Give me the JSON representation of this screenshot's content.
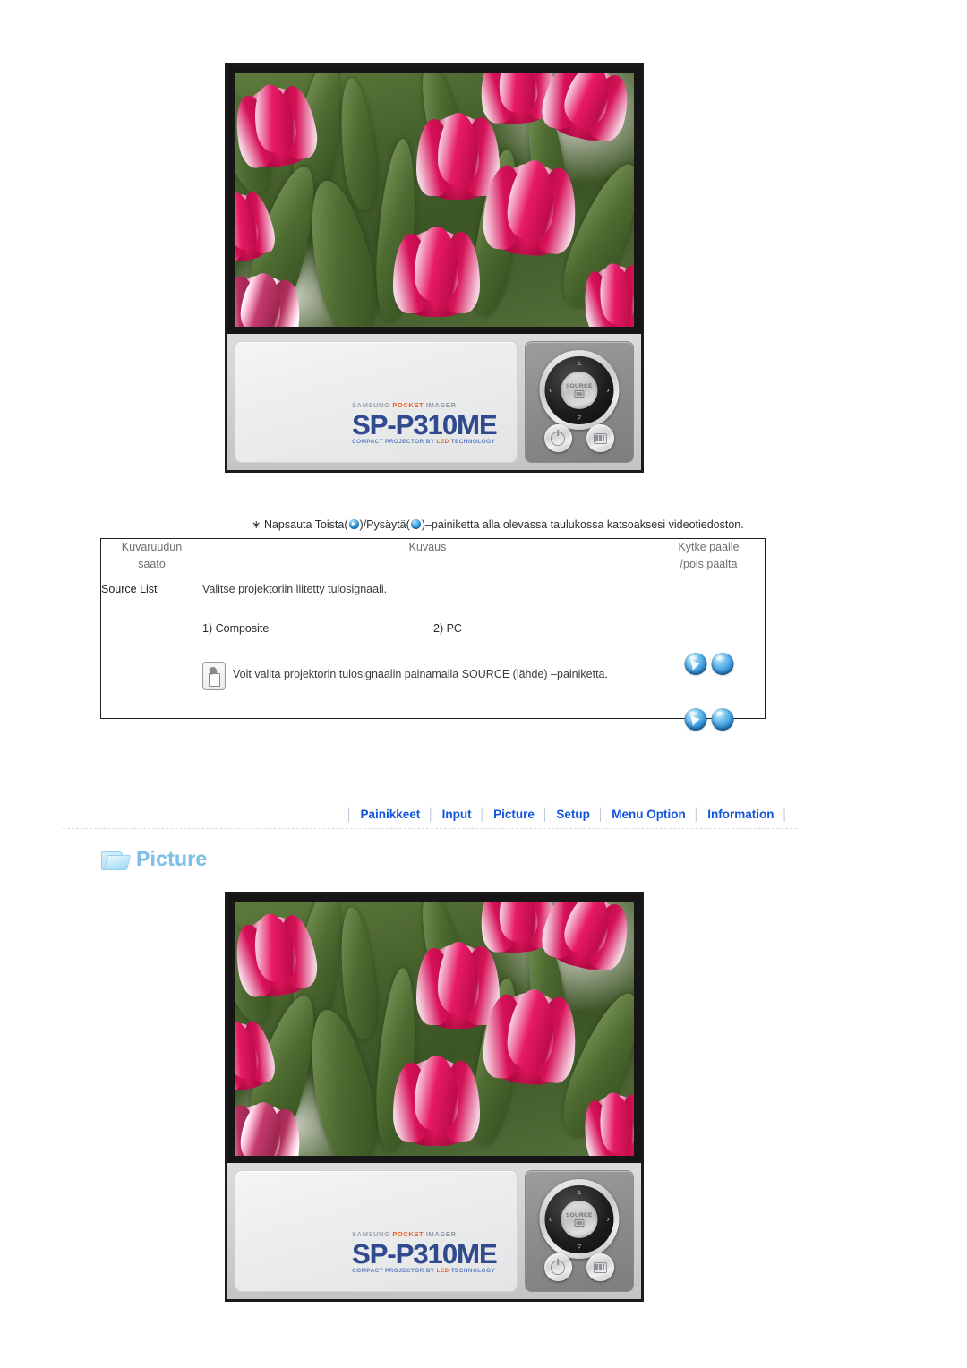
{
  "device": {
    "brand_prefix": "SAMSUNG",
    "brand_accent": "POCKET",
    "brand_suffix": "IMAGER",
    "model": "SP-P310ME",
    "tagline_pre": "COMPACT PROJECTOR BY",
    "tagline_accent": "LED",
    "tagline_post": "TECHNOLOGY",
    "source_button_label": "SOURCE"
  },
  "caption": {
    "prefix": "∗ Napsauta Toista(",
    "middle": ")/Pysäytä(",
    "suffix": ")–painiketta alla olevassa taulukossa katsoaksesi videotiedoston."
  },
  "table": {
    "headers": {
      "col1_line1": "Kuvaruudun",
      "col1_line2": "säätö",
      "col2": "Kuvaus",
      "col3_line1": "Kytke päälle",
      "col3_line2": "/pois päältä"
    },
    "row": {
      "name": "Source List",
      "description": "Valitse projektoriin liitetty tulosignaali.",
      "option1": "1) Composite",
      "option2": "2) PC",
      "note": "Voit valita projektorin tulosignaalin painamalla SOURCE (lähde) –painiketta."
    },
    "icons": {
      "play": "play-ball-icon",
      "stop": "stop-ball-icon",
      "note": "note-hand-icon"
    }
  },
  "nav": {
    "items": [
      {
        "label": "Painikkeet"
      },
      {
        "label": "Input"
      },
      {
        "label": "Picture"
      },
      {
        "label": "Setup"
      },
      {
        "label": "Menu Option"
      },
      {
        "label": "Information"
      }
    ],
    "separator": "│",
    "link_color": "#1155dd"
  },
  "section": {
    "title": "Picture",
    "icon": "folder-icon"
  }
}
